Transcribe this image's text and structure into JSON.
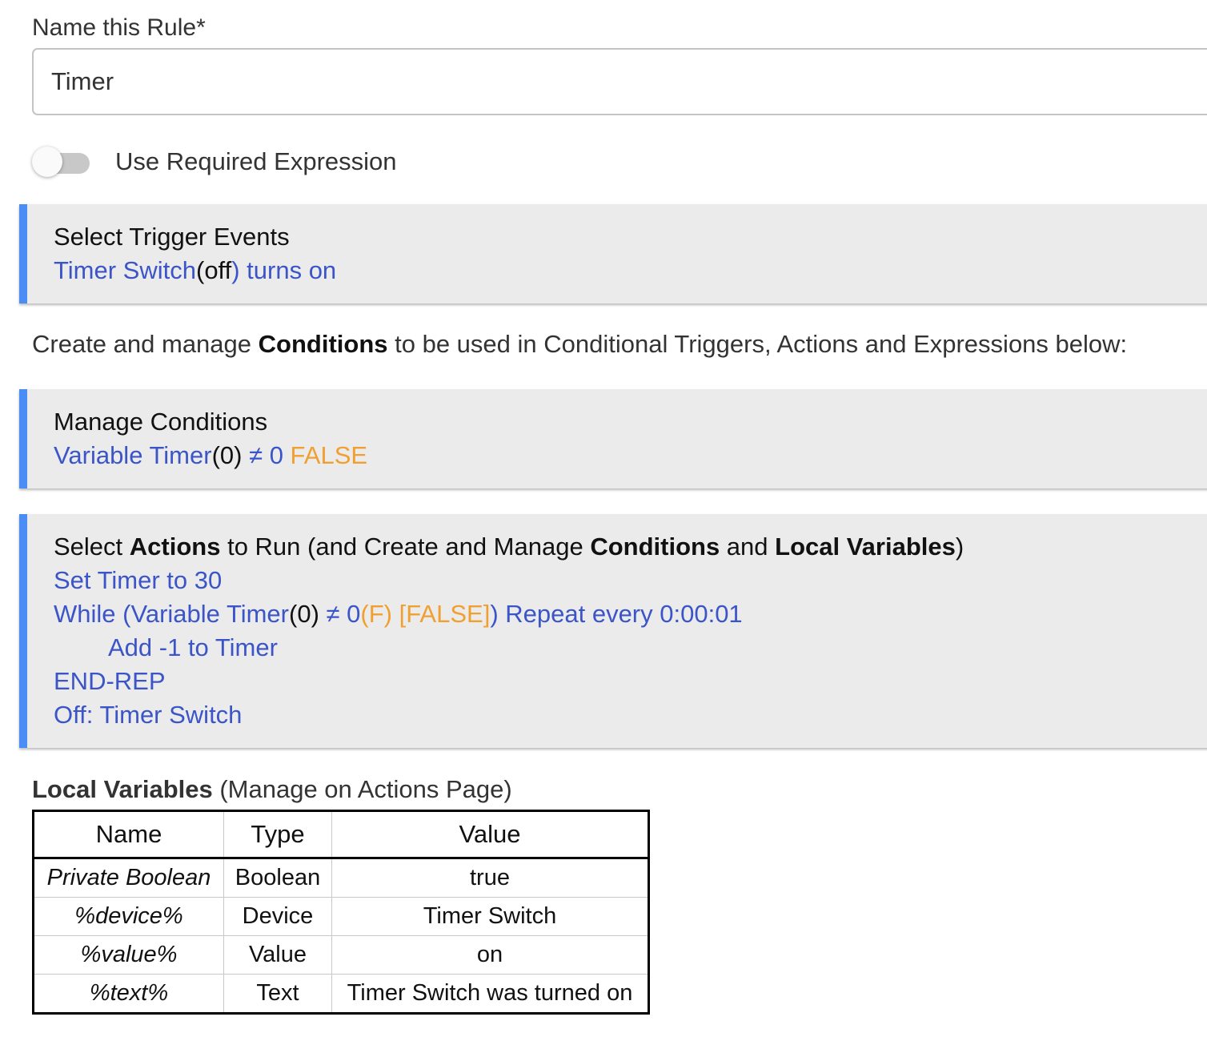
{
  "rule_name": {
    "label": "Name this Rule*",
    "value": "Timer"
  },
  "required_expression": {
    "label": "Use Required Expression",
    "enabled": false
  },
  "trigger_section": {
    "title": "Select Trigger Events",
    "device": "Timer Switch",
    "paren_open": "(",
    "state": "off",
    "paren_close": ")",
    "action": " turns on"
  },
  "conditions_info": {
    "before": "Create and manage ",
    "bold": "Conditions",
    "after": " to be used in Conditional Triggers, Actions and Expressions below:"
  },
  "conditions_section": {
    "title": "Manage Conditions",
    "variable": "Variable Timer",
    "value": "(0)",
    "comparison": " ≠ 0 ",
    "result": "FALSE"
  },
  "actions_section": {
    "title_parts": {
      "p1": "Select ",
      "b1": "Actions",
      "p2": " to Run (and Create and Manage ",
      "b2": "Conditions",
      "p3": " and ",
      "b3": "Local Variables",
      "p4": ")"
    },
    "set_timer": "Set Timer to 30",
    "while_parts": {
      "a": "While (Variable Timer",
      "b": "(0)",
      "c": " ≠ 0",
      "d": "(F) [FALSE]",
      "e": ") Repeat every 0:00:01"
    },
    "add_timer": "Add -1 to Timer",
    "end_rep": "END-REP",
    "off_action": "Off: Timer Switch"
  },
  "local_variables": {
    "heading": "Local Variables",
    "subheading": " (Manage on Actions Page)",
    "columns": [
      "Name",
      "Type",
      "Value"
    ],
    "rows": [
      {
        "name": "Private Boolean",
        "type": "Boolean",
        "value": "true"
      },
      {
        "name": "%device%",
        "type": "Device",
        "value": "Timer Switch"
      },
      {
        "name": "%value%",
        "type": "Value",
        "value": "on"
      },
      {
        "name": "%text%",
        "type": "Text",
        "value": "Timer Switch was turned on"
      }
    ]
  },
  "colors": {
    "accent_bar": "#4a8ef5",
    "link_blue": "#3b55c8",
    "false_orange": "#f0a030",
    "section_bg": "#ebebeb"
  }
}
